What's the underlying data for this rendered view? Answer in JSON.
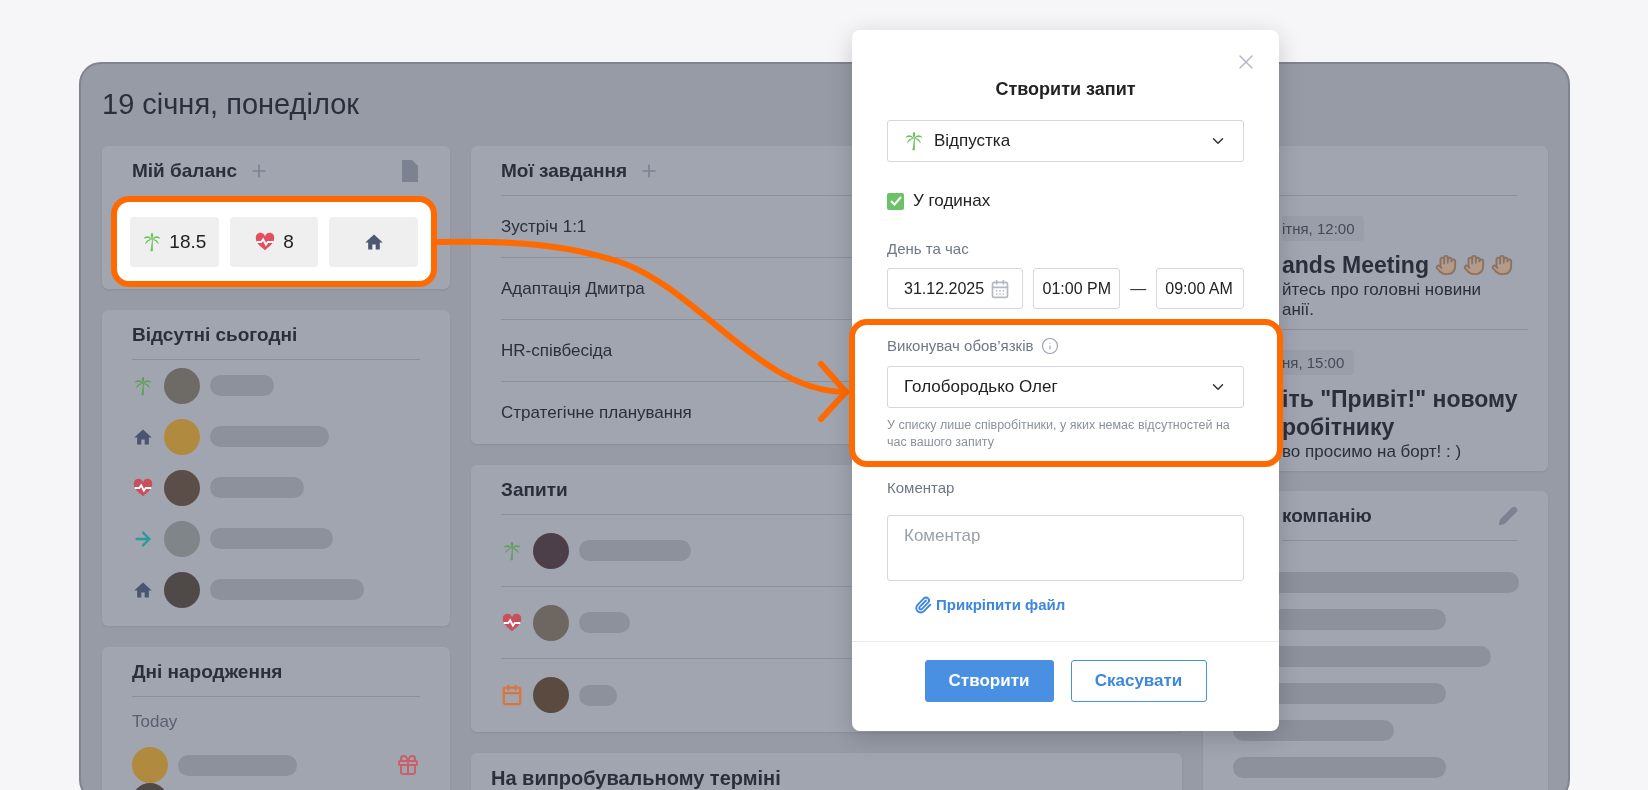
{
  "page": {
    "date_heading": "19 січня, понеділок"
  },
  "balance": {
    "title": "Мій баланс",
    "chips": [
      {
        "kind": "vacation",
        "value": "18.5"
      },
      {
        "kind": "sick",
        "value": "8"
      },
      {
        "kind": "remote"
      }
    ]
  },
  "absent": {
    "title": "Відсутні сьогодні",
    "rows": [
      {
        "kind": "vacation"
      },
      {
        "kind": "remote"
      },
      {
        "kind": "sick"
      },
      {
        "kind": "trip"
      },
      {
        "kind": "remote"
      }
    ]
  },
  "birthdays": {
    "title": "Дні народження",
    "group": "Today"
  },
  "tasks": {
    "title": "Мої завдання",
    "items": [
      "Зустріч 1:1",
      "Адаптація Дмитра",
      "HR-співбесіда",
      "Стратегічне планування"
    ]
  },
  "requests": {
    "title": "Запити",
    "rows": [
      {
        "kind": "vacation"
      },
      {
        "kind": "sick"
      },
      {
        "kind": "day_off"
      }
    ]
  },
  "probation": {
    "title": "На випробувальному терміні"
  },
  "news": {
    "items": [
      {
        "kind": "meeting",
        "time": "ітня, 12:00",
        "title_lines": [
          "ands Meeting"
        ],
        "text_lines": [
          "йтесь про головні новини",
          "анії."
        ]
      },
      {
        "kind": "welcome",
        "time": "ня, 15:00",
        "title_lines": [
          "іть \"Привіт!\" новому",
          "робітнику"
        ],
        "text_lines": [
          "во просимо на борт! : )"
        ]
      }
    ]
  },
  "company": {
    "title": "компанію"
  },
  "modal": {
    "title": "Створити запит",
    "type_select": {
      "kind": "vacation",
      "value": "Відпустка"
    },
    "in_hours": {
      "label": "У годинах",
      "checked": true
    },
    "datetime_label": "День та час",
    "date": "31.12.2025",
    "time_from": "01:00 PM",
    "time_separator": "—",
    "time_to": "09:00 AM",
    "substitute_label": "Виконувач обов’язків",
    "substitute": "Голобородько Олег",
    "substitute_hint": "У списку лише співробітники, у яких немає відсутностей на час вашого запиту",
    "comment_label": "Коментар",
    "comment_placeholder": "Коментар",
    "attach_link": "Прикріпити файл",
    "buttons": [
      {
        "kind": "primary",
        "label": "Створити"
      },
      {
        "kind": "secondary",
        "label": "Скасувати"
      }
    ]
  }
}
